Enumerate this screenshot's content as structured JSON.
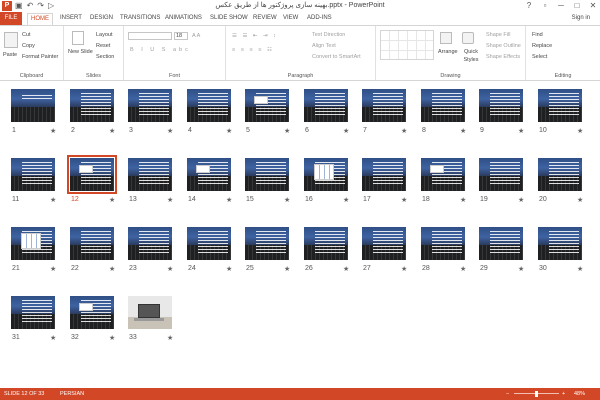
{
  "window": {
    "title": "بهینه سازی پروژکتور ها از طریق عکس.pptx - PowerPoint",
    "quick_access": [
      "save-icon",
      "undo-icon",
      "redo-icon",
      "start-from-beginning-icon"
    ],
    "controls": [
      "?",
      "▫",
      "─",
      "□",
      "✕"
    ]
  },
  "tabs": {
    "file": "FILE",
    "items": [
      "HOME",
      "INSERT",
      "DESIGN",
      "TRANSITIONS",
      "ANIMATIONS",
      "SLIDE SHOW",
      "REVIEW",
      "VIEW",
      "ADD-INS"
    ],
    "active": "HOME",
    "sign_in": "Sign in"
  },
  "ribbon": {
    "clipboard": {
      "label": "Clipboard",
      "paste": "Paste",
      "cut": "Cut",
      "copy": "Copy",
      "format_painter": "Format Painter"
    },
    "slides": {
      "label": "Slides",
      "new_slide": "New Slide",
      "layout": "Layout",
      "reset": "Reset",
      "section": "Section"
    },
    "font": {
      "label": "Font",
      "font_name": "",
      "font_size": "18"
    },
    "paragraph": {
      "label": "Paragraph",
      "text_direction": "Text Direction",
      "align_text": "Align Text",
      "convert_smartart": "Convert to SmartArt"
    },
    "drawing": {
      "label": "Drawing",
      "arrange": "Arrange",
      "quick_styles": "Quick Styles",
      "shape_fill": "Shape Fill",
      "shape_outline": "Shape Outline",
      "shape_effects": "Shape Effects"
    },
    "editing": {
      "label": "Editing",
      "find": "Find",
      "replace": "Replace",
      "select": "Select"
    }
  },
  "slides": {
    "selected": 12,
    "items": [
      {
        "num": "1",
        "type": "title"
      },
      {
        "num": "2",
        "type": "text"
      },
      {
        "num": "3",
        "type": "text"
      },
      {
        "num": "4",
        "type": "text"
      },
      {
        "num": "5",
        "type": "card"
      },
      {
        "num": "6",
        "type": "text"
      },
      {
        "num": "7",
        "type": "text"
      },
      {
        "num": "8",
        "type": "text"
      },
      {
        "num": "9",
        "type": "text"
      },
      {
        "num": "10",
        "type": "text"
      },
      {
        "num": "11",
        "type": "text"
      },
      {
        "num": "12",
        "type": "card"
      },
      {
        "num": "13",
        "type": "text"
      },
      {
        "num": "14",
        "type": "card"
      },
      {
        "num": "15",
        "type": "text"
      },
      {
        "num": "16",
        "type": "diagram"
      },
      {
        "num": "17",
        "type": "text"
      },
      {
        "num": "18",
        "type": "card"
      },
      {
        "num": "19",
        "type": "text"
      },
      {
        "num": "20",
        "type": "text"
      },
      {
        "num": "21",
        "type": "diagram"
      },
      {
        "num": "22",
        "type": "text"
      },
      {
        "num": "23",
        "type": "text"
      },
      {
        "num": "24",
        "type": "text"
      },
      {
        "num": "25",
        "type": "text"
      },
      {
        "num": "26",
        "type": "text"
      },
      {
        "num": "27",
        "type": "text"
      },
      {
        "num": "28",
        "type": "text"
      },
      {
        "num": "29",
        "type": "text"
      },
      {
        "num": "30",
        "type": "text"
      },
      {
        "num": "31",
        "type": "text"
      },
      {
        "num": "32",
        "type": "card"
      },
      {
        "num": "33",
        "type": "photo"
      }
    ],
    "star": "★"
  },
  "status": {
    "slide_info": "SLIDE 12 OF 33",
    "language": "PERSIAN",
    "zoom": "48%",
    "zoom_minus": "−",
    "zoom_plus": "+"
  },
  "colors": {
    "accent": "#d24726",
    "selected_outline": "#d24726"
  }
}
